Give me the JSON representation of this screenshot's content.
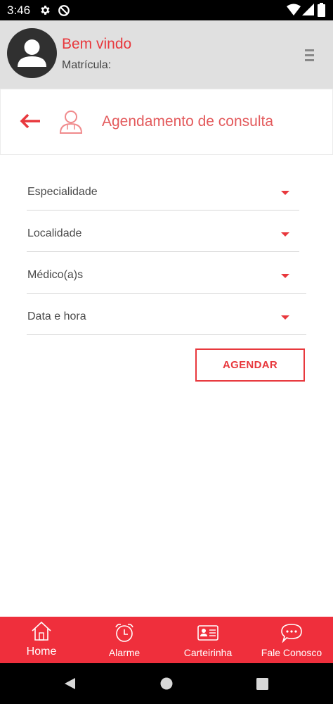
{
  "status_bar": {
    "time": "3:46",
    "icons": [
      "gear-icon",
      "at-sign-icon",
      "wifi-icon",
      "signal-icon",
      "battery-icon"
    ]
  },
  "header": {
    "welcome": "Bem vindo",
    "registration_label": "Matrícula:",
    "menu_icon": "hamburger-menu-icon"
  },
  "title_bar": {
    "title": "Agendamento de consulta",
    "back_icon": "arrow-left-icon",
    "section_icon": "doctor-icon"
  },
  "form": {
    "fields": [
      {
        "label": "Especialidade"
      },
      {
        "label": "Localidade"
      },
      {
        "label": "Médico(a)s"
      },
      {
        "label": "Data e hora"
      }
    ],
    "submit_label": "AGENDAR"
  },
  "bottom_nav": {
    "items": [
      {
        "label": "Home",
        "icon": "home-icon"
      },
      {
        "label": "Alarme",
        "icon": "alarm-clock-icon"
      },
      {
        "label": "Carteirinha",
        "icon": "id-card-icon"
      },
      {
        "label": "Fale Conosco",
        "icon": "chat-bubble-icon"
      }
    ]
  },
  "colors": {
    "accent": "#e8383d",
    "nav_background": "#ef2f3c",
    "header_background": "#e0e0e0"
  }
}
